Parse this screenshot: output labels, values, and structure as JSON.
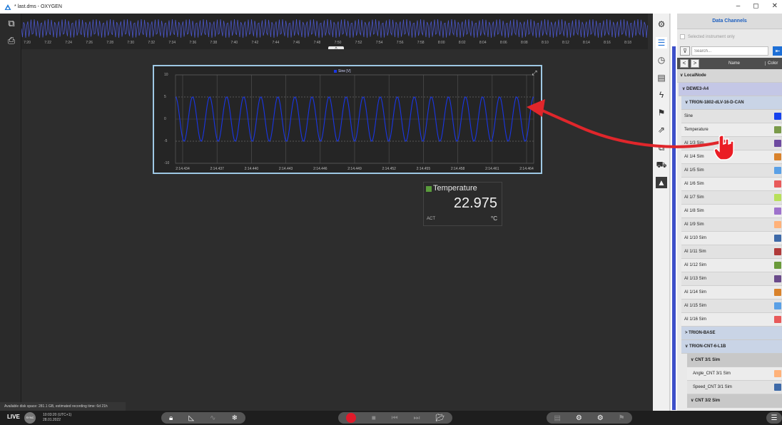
{
  "window": {
    "title": "* last.dms - OXYGEN",
    "controls": [
      "–",
      "◻",
      "✕"
    ]
  },
  "overview": {
    "ticks": [
      "7:20",
      "7:22",
      "7:24",
      "7:26",
      "7:28",
      "7:30",
      "7:32",
      "7:34",
      "7:36",
      "7:38",
      "7:40",
      "7:42",
      "7:44",
      "7:46",
      "7:48",
      "7:50",
      "7:52",
      "7:54",
      "7:56",
      "7:58",
      "8:00",
      "8:02",
      "8:04",
      "8:06",
      "8:08",
      "8:10",
      "8:12",
      "8:14",
      "8:16",
      "8:18"
    ],
    "handle_icon": "chevron-up-icon",
    "wave_color": "#4a55c8"
  },
  "recorder": {
    "legend": "Sine [V]",
    "legend_color": "#1a36e6",
    "y_ticks": [
      "10",
      "5",
      "0",
      "-5",
      "-10"
    ],
    "x_ticks": [
      "2:14.434",
      "2:14.437",
      "2:14.440",
      "2:14.443",
      "2:14.446",
      "2:14.449",
      "2:14.452",
      "2:14.455",
      "2:14.458",
      "2:14.461",
      "2:14.464"
    ],
    "expand_icon": "expand-arrows-icon",
    "signal": {
      "amplitude": 5,
      "cycles": 21,
      "color": "#1a36e6"
    }
  },
  "digital_meter": {
    "title": "Temperature",
    "value": "22.975",
    "mode": "ACT",
    "unit": "°C",
    "color": "#5a9c3c"
  },
  "status": {
    "disk": "Available disk space: 281.1 GB, estimated recording time: 6d 21h",
    "live": "LIVE",
    "sync": "SYNC",
    "time": "10:03:20 (UTC+1)",
    "date": "28.01.2022"
  },
  "bottom_toolbar": {
    "groups": [
      {
        "icons": [
          "lock-icon",
          "measure-cursor-icon",
          "dimmed-tool-icon",
          "freeze-icon"
        ]
      },
      {
        "icons": [
          "record-icon",
          "stop-icon",
          "skip-back-icon",
          "skip-forward-icon",
          "open-folder-icon"
        ]
      },
      {
        "icons": [
          "storage-icon",
          "settings-gear-icon",
          "settings-gear2-icon",
          "flag-icon"
        ]
      },
      {
        "icons": [
          "menu-list-icon"
        ]
      }
    ]
  },
  "right_toolbar_icons": [
    "gear-icon",
    "channel-list-icon",
    "clock-icon",
    "report-icon",
    "trigger-icon",
    "marker-flag-icon",
    "export-icon",
    "network-icon",
    "vehicle-icon",
    "dewesoft-logo-icon"
  ],
  "data_channels": {
    "title": "Data Channels",
    "filter_label": "Selected instrument only",
    "search_placeholder": "Search...",
    "col_name": "Name",
    "col_color": "Color",
    "nav_prev": "<",
    "nav_next": ">",
    "tree": {
      "root": "LocalNode",
      "device": "DEWE3-A4",
      "module": "TRION-1802-dLV-16-D-CAN",
      "channels": [
        {
          "name": "Sine",
          "color": "#1642ee"
        },
        {
          "name": "Temperature",
          "color": "#7a9a4a"
        },
        {
          "name": "AI 1/3 Sim",
          "color": "#6e4aa0"
        },
        {
          "name": "AI 1/4 Sim",
          "color": "#d9822b"
        },
        {
          "name": "AI 1/5 Sim",
          "color": "#5aa0e6"
        },
        {
          "name": "AI 1/6 Sim",
          "color": "#e85a5a"
        },
        {
          "name": "AI 1/7 Sim",
          "color": "#b8e05a"
        },
        {
          "name": "AI 1/8 Sim",
          "color": "#9e72cc"
        },
        {
          "name": "AI 1/9 Sim",
          "color": "#ffb27a"
        },
        {
          "name": "AI 1/10 Sim",
          "color": "#3e6aa8"
        },
        {
          "name": "AI 1/11 Sim",
          "color": "#b03a3a"
        },
        {
          "name": "AI 1/12 Sim",
          "color": "#6a9a3a"
        },
        {
          "name": "AI 1/13 Sim",
          "color": "#6a4a8a"
        },
        {
          "name": "AI 1/14 Sim",
          "color": "#d9822b"
        },
        {
          "name": "AI 1/15 Sim",
          "color": "#5aa0e6"
        },
        {
          "name": "AI 1/16 Sim",
          "color": "#e85a5a"
        }
      ],
      "module2": "TRION-BASE",
      "module3": "TRION-CNT-6-L1B",
      "sub": "CNT 3/1 Sim",
      "sub_channels": [
        {
          "name": "Angle_CNT 3/1 Sim",
          "color": "#ffb27a"
        },
        {
          "name": "Speed_CNT 3/1 Sim",
          "color": "#3e6aa8"
        }
      ],
      "sub2": "CNT 3/2 Sim"
    }
  }
}
